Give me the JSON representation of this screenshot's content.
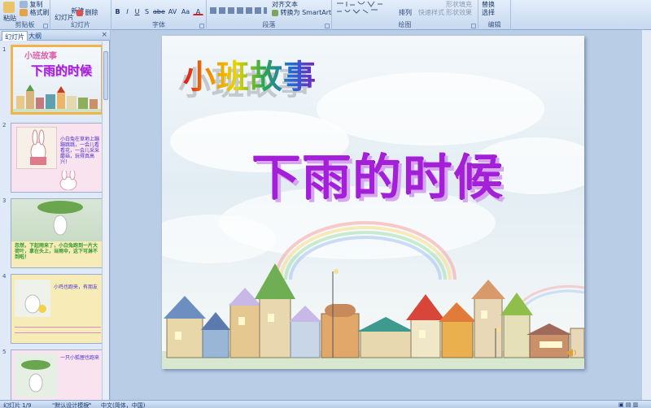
{
  "ribbon": {
    "clipboard": {
      "paste_label": "粘贴",
      "copy_label": "复制",
      "format_painter_label": "格式刷",
      "group_label": "剪贴板"
    },
    "slides": {
      "new_slide_label": "新建\n幻灯片",
      "delete_label": "删除",
      "group_label": "幻灯片"
    },
    "font": {
      "group_label": "字体",
      "buttons": [
        "B",
        "I",
        "U",
        "S",
        "abe",
        "AV",
        "Aa",
        "A"
      ]
    },
    "paragraph": {
      "group_label": "段落",
      "smartart_label": "转换为 SmartArt",
      "text_direction_label": "对齐文本"
    },
    "drawing": {
      "group_label": "绘图",
      "arrange_label": "排列",
      "quick_styles_label": "快速样式",
      "shape_fill_label": "形状填充",
      "shape_effects_label": "形状效果"
    },
    "editing": {
      "group_label": "编辑",
      "replace_label": "替换",
      "select_label": "选择"
    }
  },
  "left_panel": {
    "tabs": [
      "幻灯片",
      "大纲"
    ],
    "close_glyph": "×",
    "thumbnails": [
      {
        "num": "1",
        "title": "小班故事",
        "subtitle": "下雨的时候"
      },
      {
        "num": "2",
        "text": "小白兔在草地上蹦蹦跳跳，一会儿看看花，一会儿采采蘑菇，玩得真高兴！"
      },
      {
        "num": "3",
        "text": "忽然，下起雨来了，小白兔跑到一片大荷叶，拿在头上，当雨伞，这下可淋不到啦！"
      },
      {
        "num": "4",
        "text": "小鸡也跑来，有朋友"
      },
      {
        "num": "5",
        "text": "一只小狐狸也跑来"
      }
    ]
  },
  "slide": {
    "title": "小班故事",
    "subtitle": "下雨的时候"
  },
  "status_bar": {
    "slide_counter": "幻灯片 1/9",
    "theme": "\"默认设计模板\"",
    "language": "中文(简体，中国)"
  },
  "colors": {
    "ribbon_bg": "#dbe7f7",
    "panel_bg": "#dfe9f7",
    "canvas_bg": "#b9cde6",
    "subtitle_purple": "#a41fd8",
    "selected_border": "#f0b44a"
  }
}
